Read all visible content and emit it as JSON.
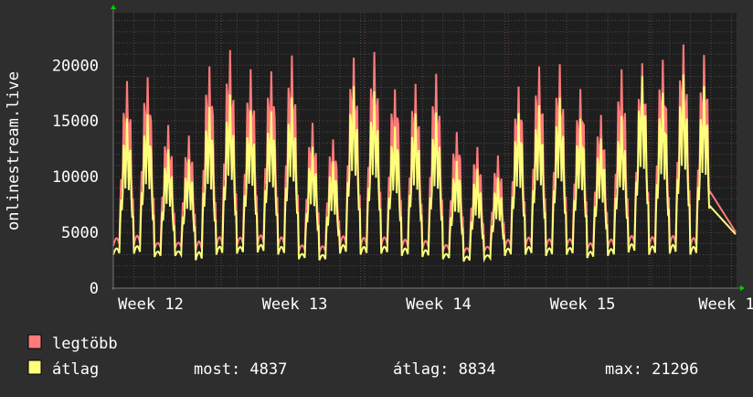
{
  "chart_data": {
    "type": "line",
    "ylabel": "onlinestream.live",
    "ylim": [
      0,
      24700
    ],
    "yticks": [
      0,
      5000,
      10000,
      15000,
      20000
    ],
    "ytick_labels": [
      "0",
      "5000",
      "10000",
      "15000",
      "20000"
    ],
    "xtick_labels": [
      "Week 12",
      "Week 13",
      "Week 14",
      "Week 15",
      "Week 1"
    ],
    "grid": true,
    "legend_placement": "bottom-left",
    "series": [
      {
        "name": "legtöbb",
        "color": "#ff7b7b",
        "daily_peaks": [
          19500,
          20600,
          14700,
          14200,
          22000,
          21500,
          20300,
          21700,
          21100,
          15200,
          15000,
          21000,
          21600,
          20300,
          18700,
          19500,
          15700,
          13000,
          12000,
          20100,
          20600,
          20200,
          19600,
          16200,
          19700,
          21900,
          21600,
          21900,
          22500
        ],
        "daily_lows": [
          3800,
          3900,
          3500,
          3600,
          3300,
          3700,
          3800,
          3900,
          3700,
          3300,
          3200,
          3800,
          3700,
          3800,
          3600,
          3500,
          3300,
          3100,
          3300,
          3600,
          3700,
          3600,
          3700,
          3400,
          3600,
          3900,
          3700,
          3800,
          3700
        ]
      },
      {
        "name": "átlag",
        "color": "#ffff7b",
        "daily_peaks": [
          16000,
          17000,
          12500,
          12000,
          18000,
          17500,
          16500,
          17700,
          17300,
          13000,
          12800,
          18400,
          18000,
          16500,
          16000,
          16000,
          12800,
          11000,
          10000,
          17500,
          17000,
          17200,
          16700,
          14000,
          15500,
          20700,
          18500,
          19200,
          19500
        ],
        "daily_lows": [
          3000,
          3100,
          2800,
          2900,
          2500,
          3000,
          3100,
          3200,
          3000,
          2600,
          2500,
          3100,
          3000,
          3100,
          2900,
          2800,
          2600,
          2400,
          2600,
          2900,
          3000,
          2900,
          3000,
          2700,
          2900,
          3200,
          3000,
          3100,
          3000
        ]
      }
    ],
    "last_value": 4837
  },
  "legend": {
    "items": [
      {
        "label": "legtöbb",
        "color": "#ff7b7b"
      },
      {
        "label": "átlag",
        "color": "#ffff7b"
      }
    ],
    "stats": {
      "most": "most: 4837",
      "atlag": "átlag: 8834",
      "max": "max: 21296"
    }
  },
  "colors": {
    "background": "#2e2e2e",
    "plot_background": "#1e1e1e",
    "grid": "#555555",
    "major_grid": "#7a3030",
    "axis_arrow": "#00cc00"
  }
}
